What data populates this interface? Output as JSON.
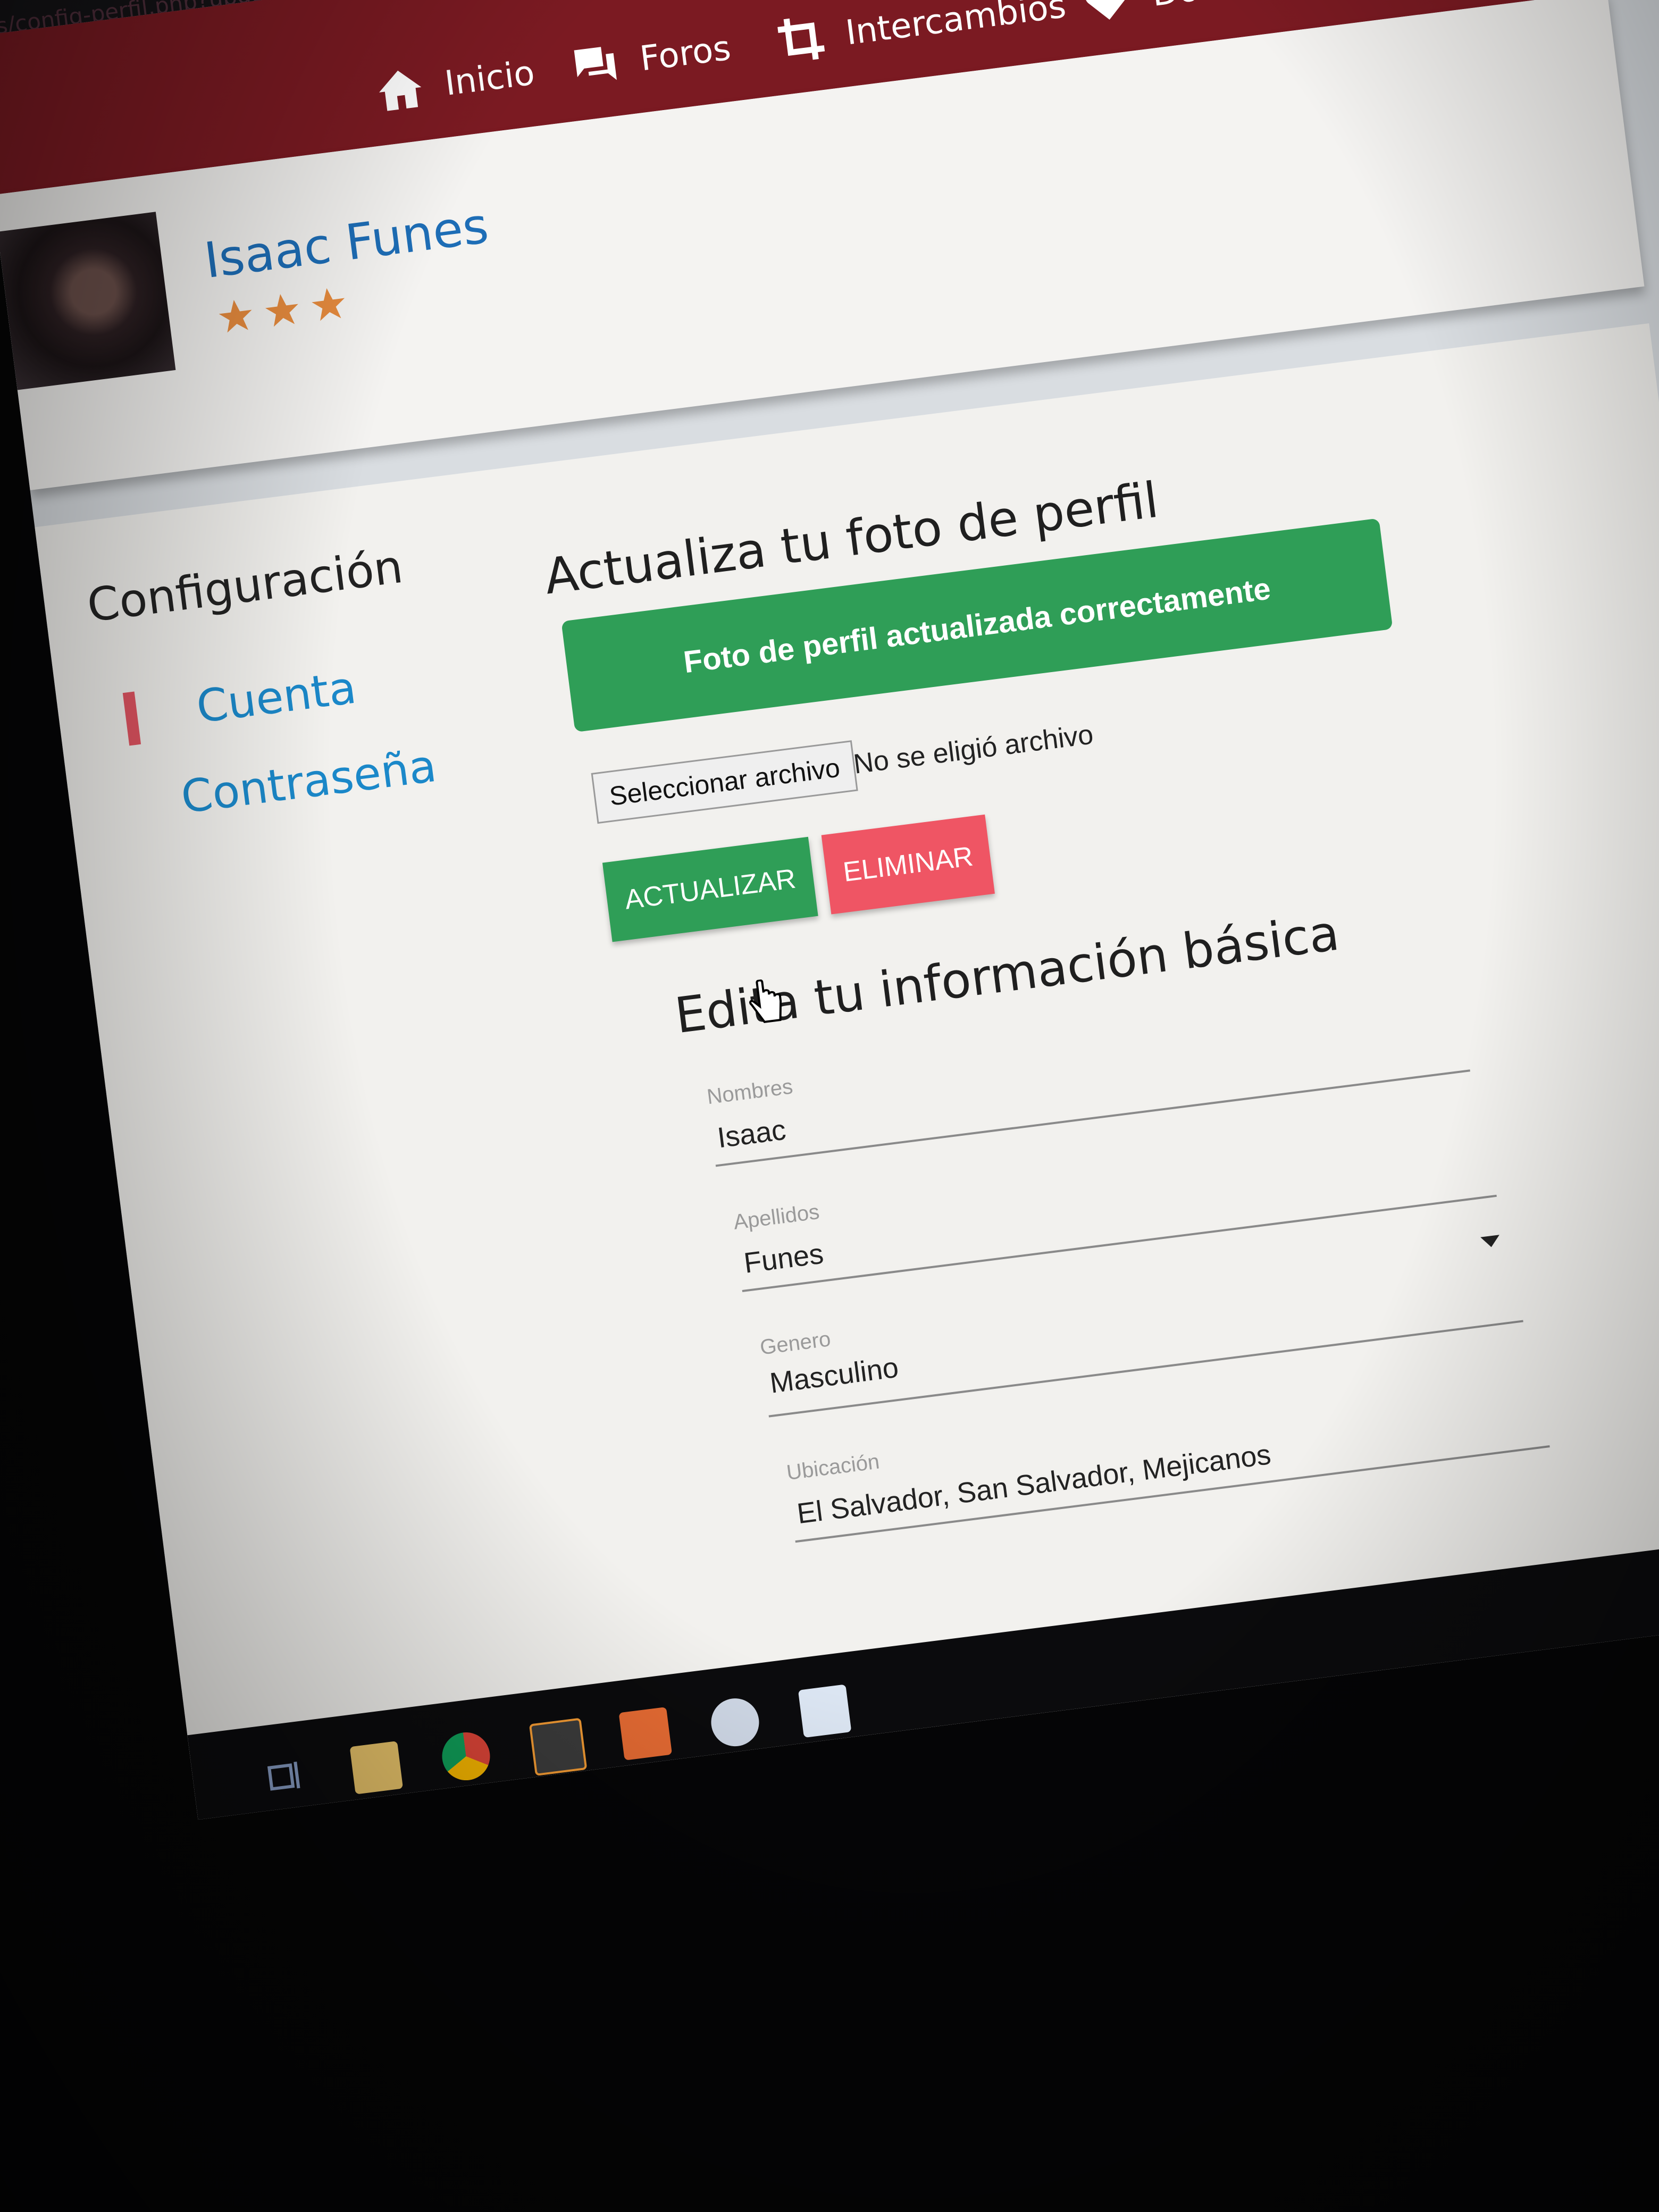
{
  "browser": {
    "url_fragment": "os/config-perfil.php?updated=true"
  },
  "nav": {
    "items": [
      {
        "label": "Inicio",
        "icon": "home-icon"
      },
      {
        "label": "Foros",
        "icon": "forum-icon"
      },
      {
        "label": "Intercambios",
        "icon": "crop-exchange-icon"
      },
      {
        "label": "Donaciones",
        "icon": "heart-icon"
      }
    ],
    "bar_color": "#7b1a22"
  },
  "profile": {
    "name": "Isaac Funes",
    "rating_stars": 3,
    "star_color": "#e58a3d"
  },
  "sidebar": {
    "title": "Configuración",
    "items": [
      {
        "label": "Cuenta",
        "active": true
      },
      {
        "label": "Contraseña",
        "active": false
      }
    ],
    "accent_color": "#e05461"
  },
  "photo_section": {
    "title": "Actualiza tu foto de perfil",
    "success_message": "Foto de perfil actualizada correctamente",
    "file_button": "Seleccionar archivo",
    "file_status": "No se eligió archivo",
    "update_button": "ACTUALIZAR",
    "delete_button": "ELIMINAR",
    "success_color": "#2f9e57",
    "danger_color": "#ef5564"
  },
  "basic_info": {
    "title": "Edita tu información básica",
    "fields": [
      {
        "label": "Nombres",
        "value": "Isaac"
      },
      {
        "label": "Apellidos",
        "value": "Funes"
      },
      {
        "label": "Genero",
        "value": "Masculino"
      },
      {
        "label": "Ubicación",
        "value": "El Salvador, San Salvador, Mejicanos"
      }
    ]
  },
  "taskbar": {
    "icons": [
      "task-view-icon",
      "file-explorer-icon",
      "chrome-icon",
      "sublime-text-icon",
      "xampp-icon",
      "paint-icon",
      "desktop-app-icon"
    ]
  }
}
